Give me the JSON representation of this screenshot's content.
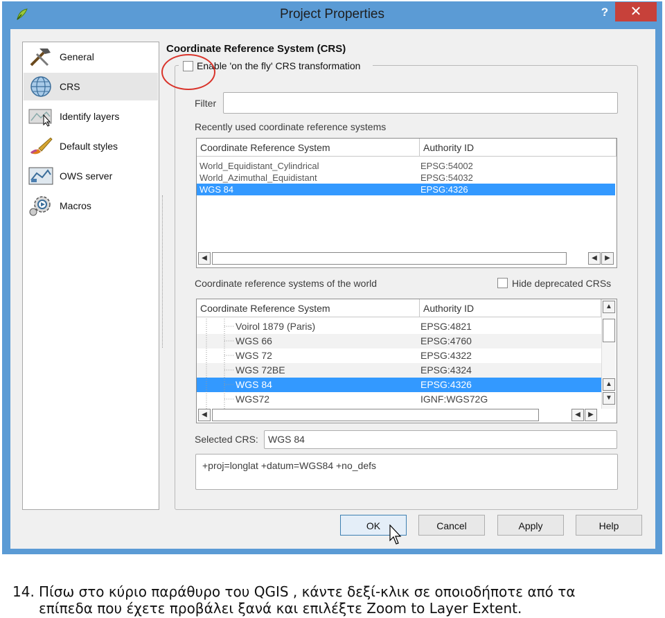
{
  "window": {
    "title": "Project Properties",
    "help_label": "?",
    "close_label": "✕",
    "app_icon": "qgis-icon"
  },
  "sidebar": {
    "items": [
      {
        "label": "General",
        "icon": "hammer-icon"
      },
      {
        "label": "CRS",
        "icon": "globe-icon"
      },
      {
        "label": "Identify layers",
        "icon": "identify-layers-icon"
      },
      {
        "label": "Default styles",
        "icon": "paintbrush-icon"
      },
      {
        "label": "OWS server",
        "icon": "ows-server-icon"
      },
      {
        "label": "Macros",
        "icon": "macros-gear-icon"
      }
    ],
    "selected": "CRS"
  },
  "crs": {
    "group_title": "Coordinate Reference System (CRS)",
    "otf_label": "Enable 'on the fly' CRS transformation",
    "otf_checked": false,
    "filter_label": "Filter",
    "filter_value": "",
    "recent_label": "Recently used coordinate reference systems",
    "recent_headers": [
      "Coordinate Reference System",
      "Authority ID"
    ],
    "recent_rows": [
      {
        "name": "World_Equidistant_Cylindrical",
        "id": "EPSG:54002"
      },
      {
        "name": "World_Azimuthal_Equidistant",
        "id": "EPSG:54032"
      },
      {
        "name": "WGS 84",
        "id": "EPSG:4326"
      }
    ],
    "recent_selected": 2,
    "world_label": "Coordinate reference systems of the world",
    "hide_deprecated_label": "Hide deprecated CRSs",
    "world_headers": [
      "Coordinate Reference System",
      "Authority ID"
    ],
    "world_rows": [
      {
        "name": "Voirol 1879 (Paris)",
        "id": "EPSG:4821"
      },
      {
        "name": "WGS 66",
        "id": "EPSG:4760"
      },
      {
        "name": "WGS 72",
        "id": "EPSG:4322"
      },
      {
        "name": "WGS 72BE",
        "id": "EPSG:4324"
      },
      {
        "name": "WGS 84",
        "id": "EPSG:4326"
      },
      {
        "name": "WGS72",
        "id": "IGNF:WGS72G"
      }
    ],
    "world_selected": 4,
    "selected_crs_label": "Selected CRS:",
    "selected_crs_value": "WGS 84",
    "proj_string": "+proj=longlat +datum=WGS84 +no_defs"
  },
  "buttons": {
    "ok": "OK",
    "cancel": "Cancel",
    "apply": "Apply",
    "help": "Help"
  },
  "caption": {
    "number": "14.",
    "line1": "Πίσω στο κύριο παράθυρο του QGIS , κάντε δεξί-κλικ σε οποιοδήποτε από τα",
    "line2": "επίπεδα που έχετε προβάλει ξανά και επιλέξτε Zoom to Layer Extent."
  },
  "colors": {
    "selection": "#3399ff",
    "close": "#c7413a",
    "window_border": "#5b9bd5",
    "annotation": "#d9342b"
  }
}
